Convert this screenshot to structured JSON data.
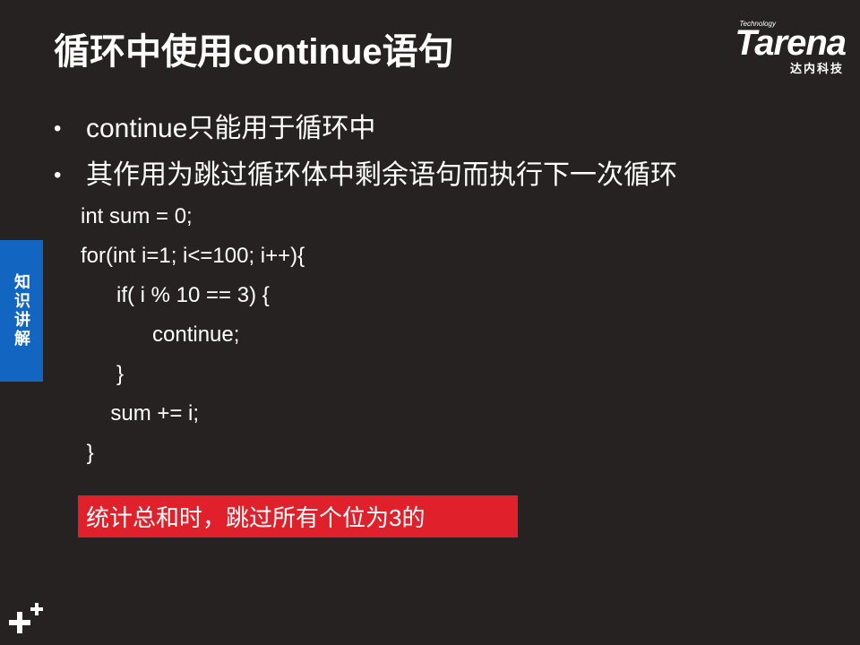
{
  "slide": {
    "title": "循环中使用continue语句",
    "logo": {
      "tech": "Technology",
      "name": "Tarena",
      "sub": "达内科技"
    },
    "bullets": [
      "continue只能用于循环中",
      "其作用为跳过循环体中剩余语句而执行下一次循环"
    ],
    "bullet_symbol": "•",
    "code_lines": [
      "int sum = 0;",
      "for(int i=1; i<=100; i++){",
      "      if( i % 10 == 3) {",
      "            continue;",
      "      }",
      "     sum += i;",
      " }"
    ],
    "side_tab": "知识讲解",
    "highlight_note": "统计总和时，跳过所有个位为3的",
    "colors": {
      "background": "#262222",
      "side_tab": "#1266c2",
      "highlight": "#e0202a",
      "text": "#ffffff"
    },
    "corner_icon": "plus-plus-icon"
  }
}
